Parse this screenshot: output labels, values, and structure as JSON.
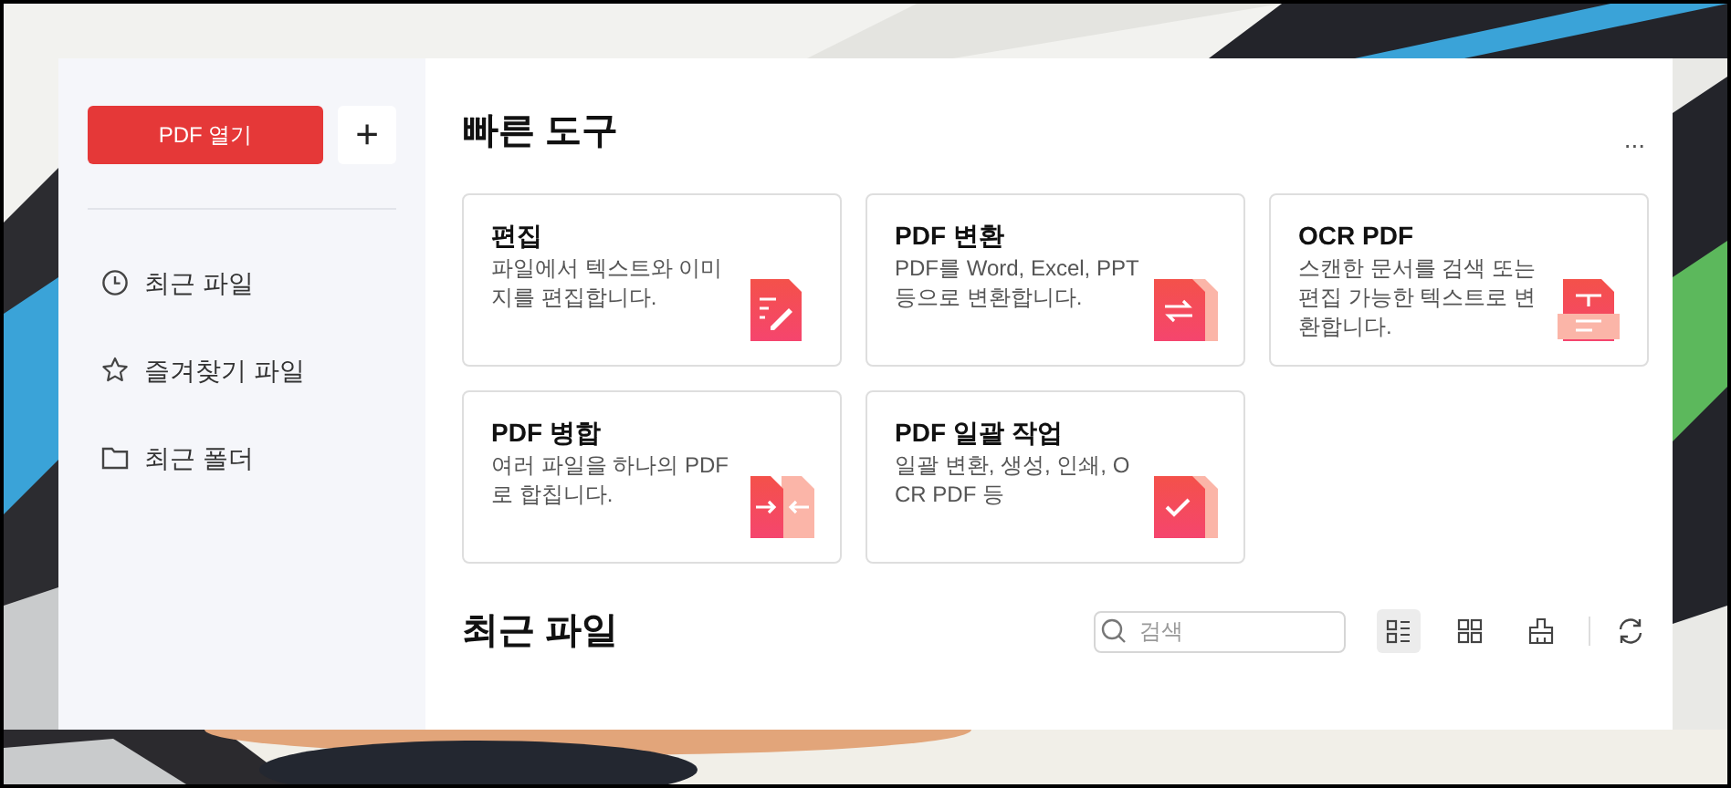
{
  "sidebar": {
    "open_button": "PDF 열기",
    "add_button": "+",
    "items": [
      {
        "kind": "clock",
        "label": "최근 파일"
      },
      {
        "kind": "star",
        "label": "즐겨찾기 파일"
      },
      {
        "kind": "folder",
        "label": "최근 폴더"
      }
    ]
  },
  "quick_tools": {
    "title": "빠른 도구",
    "more": "...",
    "cards": [
      {
        "kind": "edit",
        "title": "편집",
        "description": "파일에서 텍스트와 이미지를 편집합니다."
      },
      {
        "kind": "convert",
        "title": "PDF 변환",
        "description": "PDF를 Word, Excel, PPT 등으로 변환합니다."
      },
      {
        "kind": "ocr",
        "title": "OCR PDF",
        "description": "스캔한 문서를 검색 또는 편집 가능한 텍스트로 변환합니다."
      },
      {
        "kind": "merge",
        "title": "PDF 병합",
        "description": "여러 파일을 하나의 PDF로 합칩니다."
      },
      {
        "kind": "batch",
        "title": "PDF 일괄 작업",
        "description": "일괄 변환, 생성, 인쇄, OCR PDF 등"
      }
    ]
  },
  "recent_files": {
    "title": "최근 파일",
    "search": {
      "placeholder": "검색"
    },
    "tools": [
      {
        "kind": "list",
        "selected": true
      },
      {
        "kind": "grid",
        "selected": false
      },
      {
        "kind": "clean",
        "selected": false
      }
    ]
  }
}
